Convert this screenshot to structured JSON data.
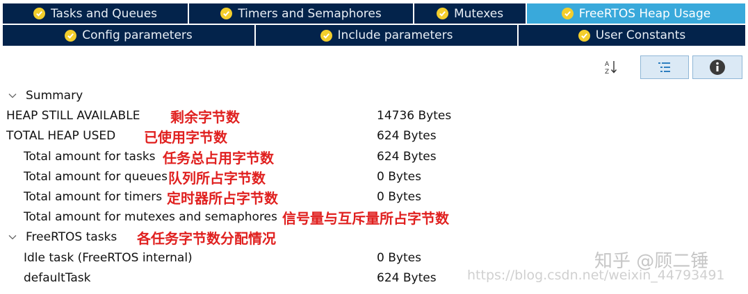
{
  "tabs_row1": [
    {
      "label": "Tasks and Queues",
      "active": false
    },
    {
      "label": "Timers and Semaphores",
      "active": false
    },
    {
      "label": "Mutexes",
      "active": false
    },
    {
      "label": "FreeRTOS Heap Usage",
      "active": true
    }
  ],
  "tabs_row2": [
    {
      "label": "Config parameters"
    },
    {
      "label": "Include parameters"
    },
    {
      "label": "User Constants"
    }
  ],
  "toolbar": {
    "sort_icon": "sort-az-icon",
    "list_icon": "list-view-icon",
    "info_icon": "info-icon"
  },
  "summary": {
    "header": "Summary",
    "heap_available": {
      "label": "HEAP STILL AVAILABLE",
      "value": "14736  Bytes",
      "note": "剩余字节数"
    },
    "heap_used": {
      "label": "TOTAL HEAP USED",
      "value": "624  Bytes",
      "note": "已使用字节数"
    },
    "tasks": {
      "label": "Total amount for tasks",
      "value": "624  Bytes",
      "note": "任务总占用字节数"
    },
    "queues": {
      "label": "Total amount for queues",
      "value": "0  Bytes",
      "note": "队列所占字节数"
    },
    "timers": {
      "label": "Total amount for timers",
      "value": "0  Bytes",
      "note": "定时器所占字节数"
    },
    "mutexes": {
      "label": "Total amount for mutexes and semaphores",
      "note": "信号量与互斥量所占字节数"
    }
  },
  "freertos_tasks": {
    "header": "FreeRTOS tasks",
    "note": "各任务字节数分配情况",
    "idle": {
      "label": "Idle task (FreeRTOS internal)",
      "value": "0  Bytes"
    },
    "default": {
      "label": "defaultTask",
      "value": "624  Bytes"
    }
  },
  "watermark": {
    "zhihu": "知乎 @顾二锤",
    "url": "https://blog.csdn.net/weixin_44793491"
  },
  "colors": {
    "tab_bg": "#03234b",
    "tab_active": "#39a9db",
    "check": "#f3ce2c",
    "note": "#e0201f"
  }
}
